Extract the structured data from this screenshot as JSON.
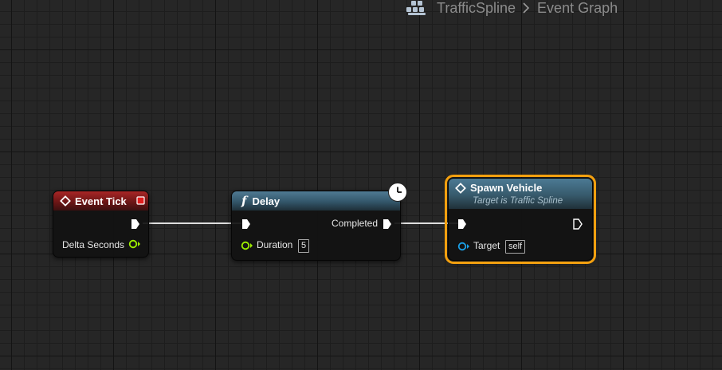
{
  "breadcrumb": {
    "items": [
      "TrafficSpline",
      "Event Graph"
    ],
    "icon": "blueprint-icon"
  },
  "nodes": {
    "event_tick": {
      "title": "Event Tick",
      "icon": "event-diamond-icon",
      "outputs": {
        "delta_seconds": "Delta Seconds"
      }
    },
    "delay": {
      "title": "Delay",
      "icon": "function-icon",
      "badge_icon": "clock-icon",
      "outputs": {
        "completed": "Completed"
      },
      "inputs": {
        "duration_label": "Duration",
        "duration_value": "5"
      }
    },
    "spawn_vehicle": {
      "title": "Spawn Vehicle",
      "subtitle": "Target is Traffic Spline",
      "icon": "event-diamond-icon",
      "inputs": {
        "target_label": "Target",
        "target_value": "self"
      },
      "selected": true
    }
  },
  "colors": {
    "event_header": "#a82626",
    "function_header": "#4f7a93",
    "selection_outline": "#f3a00f",
    "float_pin": "#9ff000",
    "object_pin": "#1aa0e8",
    "exec_pin": "#ffffff"
  }
}
